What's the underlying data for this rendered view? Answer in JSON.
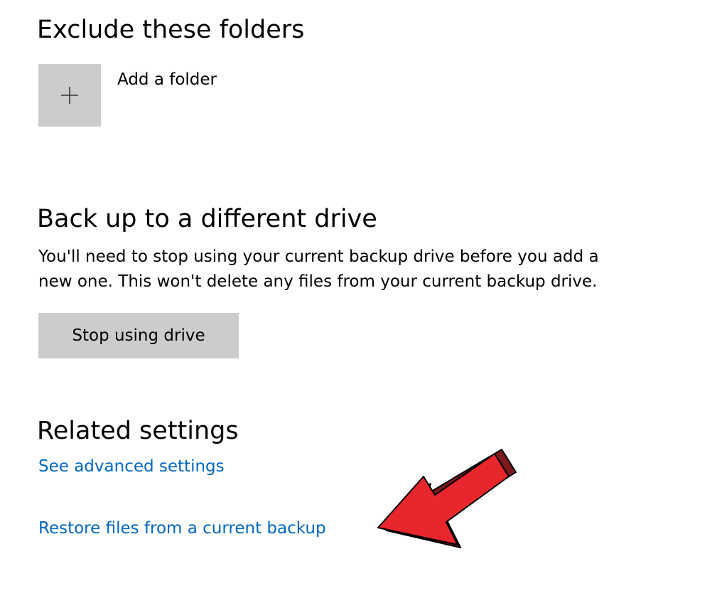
{
  "exclude_section": {
    "title": "Exclude these folders",
    "add_folder_label": "Add a folder"
  },
  "backup_section": {
    "title": "Back up to a different drive",
    "description_line1": "You'll need to stop using your current backup drive before you add a",
    "description_line2": "new one. This won't delete any files from your current backup drive.",
    "stop_button_label": "Stop using drive"
  },
  "related_section": {
    "title": "Related settings",
    "advanced_link": "See advanced settings",
    "restore_link": "Restore files from a current backup"
  },
  "icons": {
    "add_folder": "plus-icon",
    "annotation": "red-arrow-icon"
  },
  "colors": {
    "link": "#0067c0",
    "tile_background": "#cccccc",
    "arrow_red": "#e8262d",
    "arrow_shadow": "#7a1a1c"
  }
}
